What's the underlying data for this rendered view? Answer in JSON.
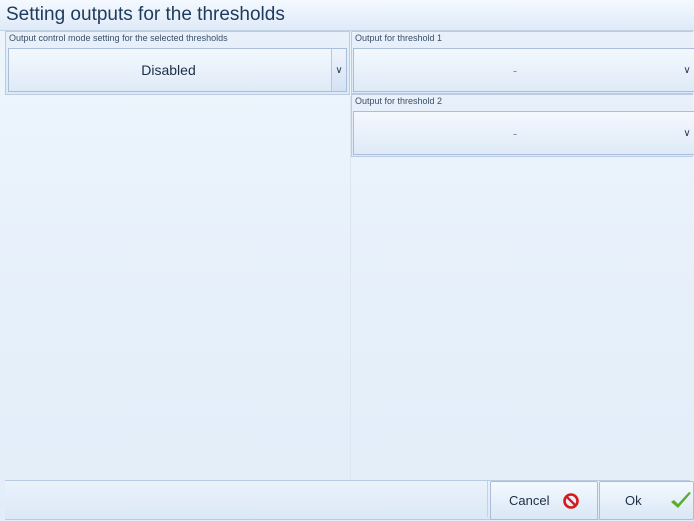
{
  "window": {
    "title": "Setting outputs for the thresholds"
  },
  "mode": {
    "label": "Output control mode setting for the selected thresholds",
    "value": "Disabled"
  },
  "threshold1": {
    "label": "Output for threshold 1",
    "value": "-"
  },
  "threshold2": {
    "label": "Output for threshold 2",
    "value": "-"
  },
  "footer": {
    "status_text": "",
    "cancel_label": "Cancel",
    "ok_label": "Ok"
  },
  "icons": {
    "cancel": "no-entry-icon",
    "ok": "check-icon",
    "dropdown": "chevron-down-icon"
  },
  "colors": {
    "cancel_icon": "#d7191c",
    "ok_icon": "#5cab2a",
    "title_text": "#1e3a5c"
  }
}
